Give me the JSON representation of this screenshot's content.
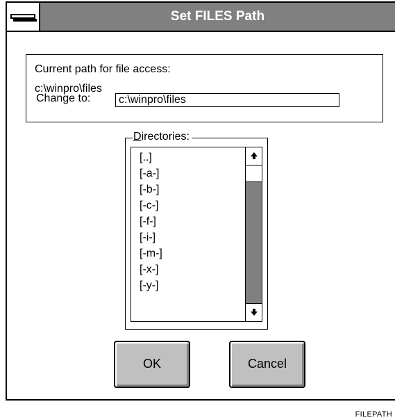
{
  "window": {
    "title": "Set FILES Path"
  },
  "path_section": {
    "current_label": "Current path for file access:",
    "current_path": "c:\\winpro\\files",
    "change_label": "Change to:",
    "change_value": "c:\\winpro\\files"
  },
  "directories": {
    "label_hotkey": "D",
    "label_rest": "irectories:",
    "items": [
      "[..]",
      "[-a-]",
      "[-b-]",
      "[-c-]",
      "[-f-]",
      "[-i-]",
      "[-m-]",
      "[-x-]",
      "[-y-]"
    ]
  },
  "buttons": {
    "ok": "OK",
    "cancel": "Cancel"
  },
  "caption": "FILEPATH",
  "icons": {
    "system_menu": "system-menu-icon",
    "scroll_up": "up-arrow-icon",
    "scroll_down": "down-arrow-icon"
  },
  "colors": {
    "title_bar": "#808080",
    "button_face": "#c0c0c0",
    "scroll_track": "#808080"
  }
}
